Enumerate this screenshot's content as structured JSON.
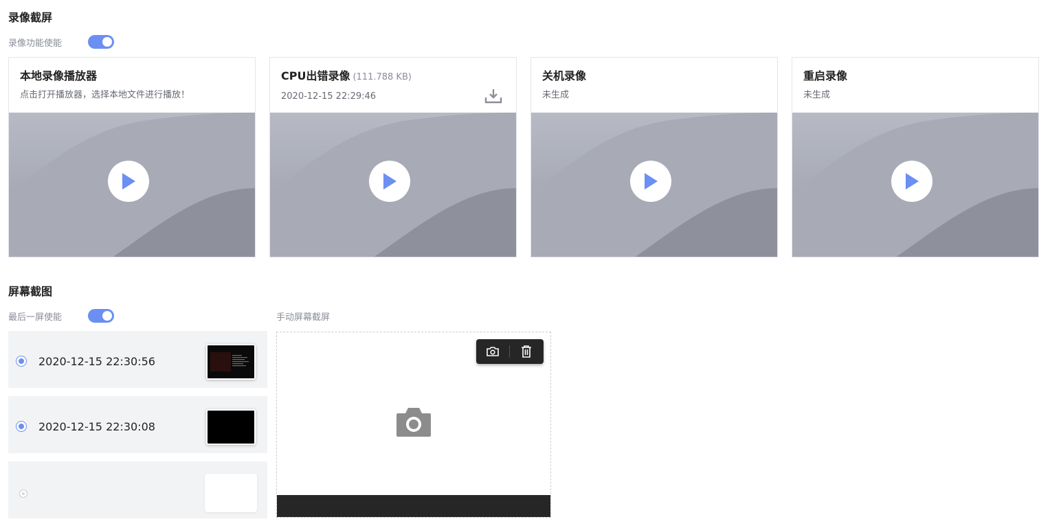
{
  "recording": {
    "title": "录像截屏",
    "toggle_label": "录像功能使能",
    "toggle_on": true,
    "cards": [
      {
        "title": "本地录像播放器",
        "size": "",
        "subtitle": "点击打开播放器，选择本地文件进行播放！",
        "downloadable": false
      },
      {
        "title": "CPU出错录像",
        "size": "(111.788 KB)",
        "subtitle": "2020-12-15 22:29:46",
        "downloadable": true
      },
      {
        "title": "关机录像",
        "size": "",
        "subtitle": "未生成",
        "downloadable": false
      },
      {
        "title": "重启录像",
        "size": "",
        "subtitle": "未生成",
        "downloadable": false
      }
    ]
  },
  "screenshot": {
    "title": "屏幕截图",
    "toggle_label": "最后一屏使能",
    "toggle_on": true,
    "items": [
      {
        "time": "2020-12-15 22:30:56",
        "selected": true
      },
      {
        "time": "2020-12-15 22:30:08",
        "selected": true
      },
      {
        "time": "",
        "selected": false
      }
    ],
    "manual_label": "手动屏幕截屏",
    "icons": [
      "camera-icon",
      "trash-icon",
      "camera-placeholder-icon"
    ]
  },
  "colors": {
    "accent": "#6b8ff2",
    "row_bg": "#f2f3f5",
    "toolbar_bg": "#262626"
  }
}
